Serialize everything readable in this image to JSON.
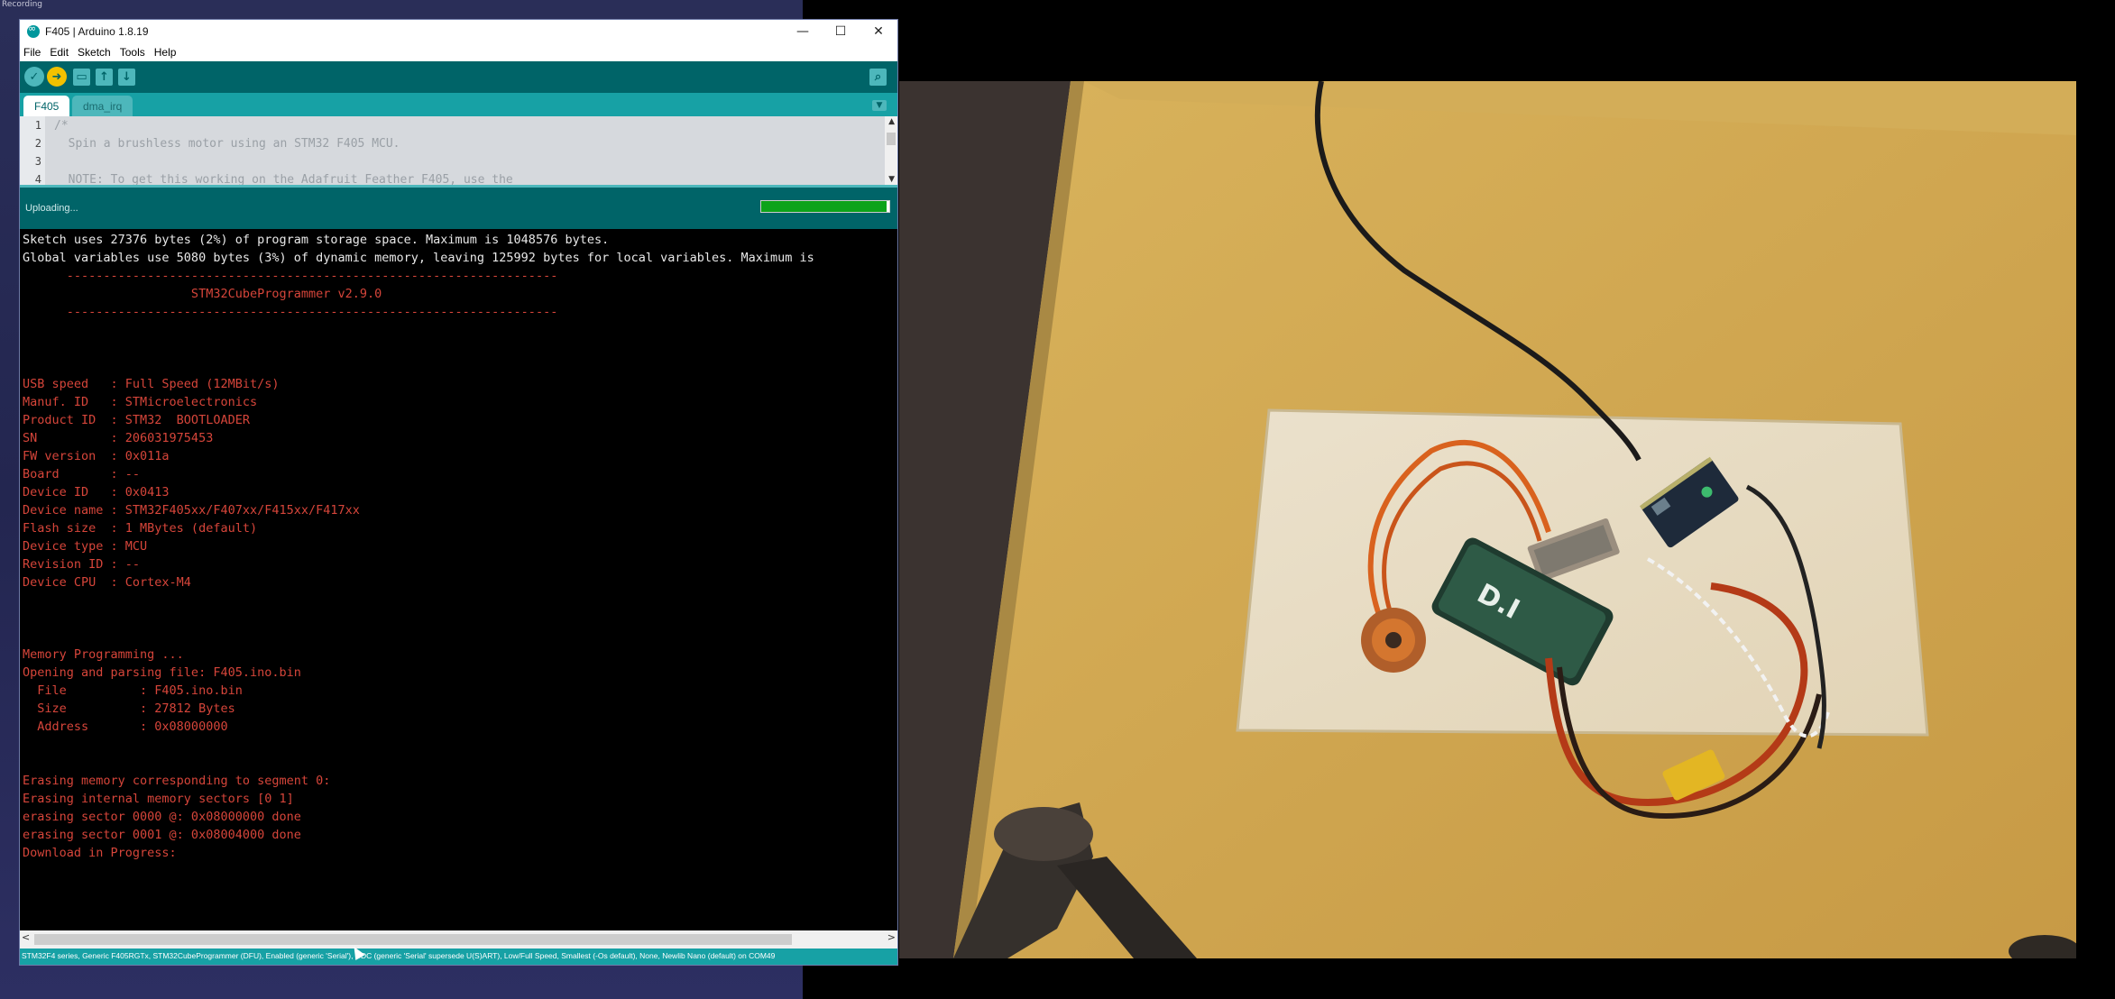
{
  "desktop": {
    "label": "Recording"
  },
  "window": {
    "title": "F405 | Arduino 1.8.19",
    "controls": {
      "minimize": "—",
      "maximize": "☐",
      "close": "✕"
    }
  },
  "menu": [
    "File",
    "Edit",
    "Sketch",
    "Tools",
    "Help"
  ],
  "toolbar": {
    "verify": "✓",
    "upload": "➜",
    "new": "▭",
    "open": "↑",
    "save": "↓",
    "serial": "⌕"
  },
  "tabs": [
    {
      "label": "F405"
    },
    {
      "label": "dma_irq"
    }
  ],
  "editor": {
    "lines": [
      {
        "no": "1",
        "text": "/*"
      },
      {
        "no": "2",
        "text": "  Spin a brushless motor using an STM32 F405 MCU."
      },
      {
        "no": "3",
        "text": ""
      },
      {
        "no": "4",
        "text": "  NOTE: To get this working on the Adafruit Feather F405, use the"
      }
    ]
  },
  "status": {
    "text": "Uploading...",
    "progress": 0.98
  },
  "console": {
    "lines": [
      {
        "text": "Sketch uses 27376 bytes (2%) of program storage space. Maximum is 1048576 bytes.",
        "color": "white"
      },
      {
        "text": "Global variables use 5080 bytes (3%) of dynamic memory, leaving 125992 bytes for local variables. Maximum is",
        "color": "white"
      },
      {
        "text": "      -------------------------------------------------------------------",
        "color": "orange"
      },
      {
        "text": "                       STM32CubeProgrammer v2.9.0",
        "color": "orange"
      },
      {
        "text": "      -------------------------------------------------------------------",
        "color": "orange"
      },
      {
        "text": "",
        "color": "orange"
      },
      {
        "text": "",
        "color": "orange"
      },
      {
        "text": "",
        "color": "orange"
      },
      {
        "text": "USB speed   : Full Speed (12MBit/s)",
        "color": "orange"
      },
      {
        "text": "Manuf. ID   : STMicroelectronics",
        "color": "orange"
      },
      {
        "text": "Product ID  : STM32  BOOTLOADER",
        "color": "orange"
      },
      {
        "text": "SN          : 206031975453",
        "color": "orange"
      },
      {
        "text": "FW version  : 0x011a",
        "color": "orange"
      },
      {
        "text": "Board       : --",
        "color": "orange"
      },
      {
        "text": "Device ID   : 0x0413",
        "color": "orange"
      },
      {
        "text": "Device name : STM32F405xx/F407xx/F415xx/F417xx",
        "color": "orange"
      },
      {
        "text": "Flash size  : 1 MBytes (default)",
        "color": "orange"
      },
      {
        "text": "Device type : MCU",
        "color": "orange"
      },
      {
        "text": "Revision ID : --",
        "color": "orange"
      },
      {
        "text": "Device CPU  : Cortex-M4",
        "color": "orange"
      },
      {
        "text": "",
        "color": "orange"
      },
      {
        "text": "",
        "color": "orange"
      },
      {
        "text": "",
        "color": "orange"
      },
      {
        "text": "Memory Programming ...",
        "color": "orange"
      },
      {
        "text": "Opening and parsing file: F405.ino.bin",
        "color": "orange"
      },
      {
        "text": "  File          : F405.ino.bin",
        "color": "orange"
      },
      {
        "text": "  Size          : 27812 Bytes",
        "color": "orange"
      },
      {
        "text": "  Address       : 0x08000000",
        "color": "orange"
      },
      {
        "text": "",
        "color": "orange"
      },
      {
        "text": "",
        "color": "orange"
      },
      {
        "text": "Erasing memory corresponding to segment 0:",
        "color": "orange"
      },
      {
        "text": "Erasing internal memory sectors [0 1]",
        "color": "orange"
      },
      {
        "text": "erasing sector 0000 @: 0x08000000 done",
        "color": "orange"
      },
      {
        "text": "erasing sector 0001 @: 0x08004000 done",
        "color": "orange"
      },
      {
        "text": "Download in Progress:",
        "color": "orange"
      }
    ]
  },
  "footer": {
    "board_info": "STM32F4 series, Generic F405RGTx, STM32CubeProgrammer (DFU), Enabled (generic 'Serial'), CDC (generic 'Serial' supersede U(S)ART), Low/Full Speed, Smallest (-Os default), None, Newlib Nano (default) on COM49"
  },
  "colors": {
    "toolbar_bg": "#006468",
    "tab_bg": "#17a1a5",
    "console_bg": "#000000",
    "console_text_orange": "#d6453a",
    "progress_fill": "#0ca31a"
  }
}
